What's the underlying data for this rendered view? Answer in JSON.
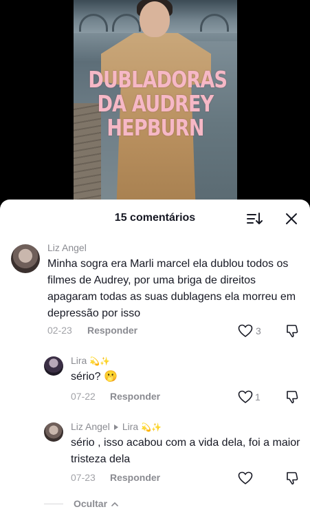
{
  "video": {
    "overlay_lines": [
      "DUBLADORAS",
      "DA AUDREY",
      "HEPBURN"
    ]
  },
  "sheet": {
    "title": "15 comentários",
    "icons": [
      "sort-icon",
      "close-icon"
    ]
  },
  "comments": [
    {
      "user": "Liz Angel",
      "text": "Minha sogra era Marli marcel ela dublou todos os filmes de Audrey, por uma briga de direitos apagaram todas as suas dublagens ela morreu em depressão por isso",
      "date": "02-23",
      "reply_label": "Responder",
      "likes": "3"
    }
  ],
  "replies": [
    {
      "user": "Lira",
      "badge": "💫✨",
      "text": "sério? 🫢",
      "date": "07-22",
      "reply_label": "Responder",
      "likes": "1"
    },
    {
      "user": "Liz Angel",
      "reply_to": "Lira",
      "badge": "💫✨",
      "text": "sério , isso acabou com a vida dela, foi a maior tristeza dela",
      "date": "07-23",
      "reply_label": "Responder",
      "likes": ""
    }
  ],
  "hide_label": "Ocultar",
  "colors": {
    "overlay_text": "#f6b8c6",
    "title_text": "#161823",
    "muted_text": "#8a8b91"
  }
}
